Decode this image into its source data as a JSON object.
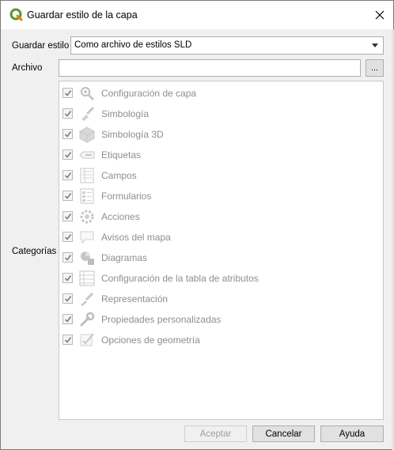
{
  "window": {
    "title": "Guardar estilo de la capa",
    "close_glyph": "✕"
  },
  "form": {
    "style_label": "Guardar estilo",
    "style_value": "Como archivo de estilos SLD",
    "file_label": "Archivo",
    "file_value": "",
    "browse_label": "...",
    "categories_label": "Categorías"
  },
  "categories": [
    {
      "label": "Configuración de capa",
      "checked": true,
      "icon": "layer-settings-icon"
    },
    {
      "label": "Simbología",
      "checked": true,
      "icon": "symbology-icon"
    },
    {
      "label": "Simbología 3D",
      "checked": true,
      "icon": "symbology-3d-icon"
    },
    {
      "label": "Etiquetas",
      "checked": true,
      "icon": "labels-icon"
    },
    {
      "label": "Campos",
      "checked": true,
      "icon": "fields-icon"
    },
    {
      "label": "Formularios",
      "checked": true,
      "icon": "forms-icon"
    },
    {
      "label": "Acciones",
      "checked": true,
      "icon": "actions-icon"
    },
    {
      "label": "Avisos del mapa",
      "checked": true,
      "icon": "map-tips-icon"
    },
    {
      "label": "Diagramas",
      "checked": true,
      "icon": "diagrams-icon"
    },
    {
      "label": "Configuración de la tabla de atributos",
      "checked": true,
      "icon": "attribute-table-icon"
    },
    {
      "label": "Representación",
      "checked": true,
      "icon": "rendering-icon"
    },
    {
      "label": "Propiedades personalizadas",
      "checked": true,
      "icon": "custom-properties-icon"
    },
    {
      "label": "Opciones de geometría",
      "checked": true,
      "icon": "geometry-options-icon"
    }
  ],
  "buttons": {
    "accept": "Aceptar",
    "cancel": "Cancelar",
    "help": "Ayuda"
  },
  "colors": {
    "qgis_green": "#589632",
    "qgis_yellow": "#ee7913",
    "disabled_text": "#8e8e8e"
  }
}
